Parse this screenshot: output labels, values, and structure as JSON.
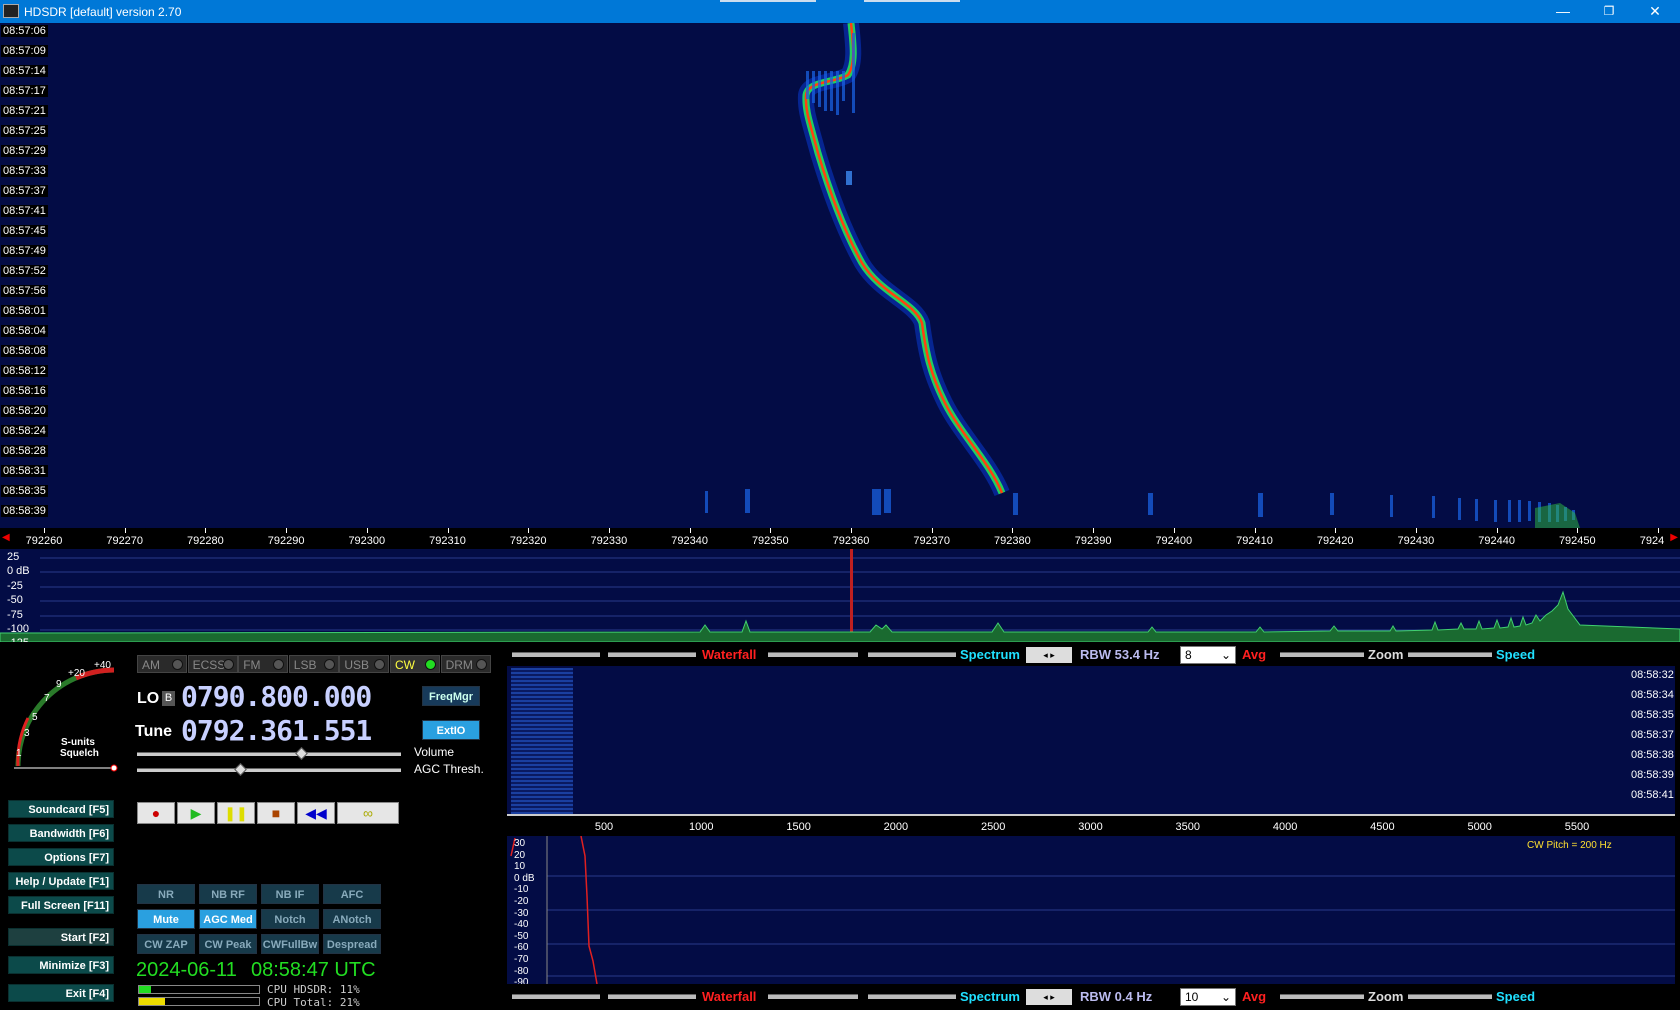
{
  "title": "HDSDR [default]  version 2.70",
  "window_buttons": {
    "minimize": "—",
    "restore": "❐",
    "close": "✕"
  },
  "waterfall": {
    "times": [
      "08:57:06",
      "08:57:09",
      "08:57:14",
      "08:57:17",
      "08:57:21",
      "08:57:25",
      "08:57:29",
      "08:57:33",
      "08:57:37",
      "08:57:41",
      "08:57:45",
      "08:57:49",
      "08:57:52",
      "08:57:56",
      "08:58:01",
      "08:58:04",
      "08:58:08",
      "08:58:12",
      "08:58:16",
      "08:58:20",
      "08:58:24",
      "08:58:28",
      "08:58:31",
      "08:58:35",
      "08:58:39"
    ],
    "frequencies": [
      "792260",
      "792270",
      "792280",
      "792290",
      "792300",
      "792310",
      "792320",
      "792330",
      "792340",
      "792350",
      "792360",
      "792370",
      "792380",
      "792390",
      "792400",
      "792410",
      "792420",
      "792430",
      "792440",
      "792450",
      "7924"
    ]
  },
  "spectrum": {
    "db_labels": [
      "25",
      "0 dB",
      "-25",
      "-50",
      "-75",
      "-100",
      "-125"
    ]
  },
  "smeter": {
    "labels": [
      "1",
      "3",
      "5",
      "7",
      "9",
      "+20",
      "+40"
    ],
    "caption1": "S-units",
    "caption2": "Squelch"
  },
  "modes": [
    {
      "label": "AM",
      "active": false
    },
    {
      "label": "ECSS",
      "active": false
    },
    {
      "label": "FM",
      "active": false
    },
    {
      "label": "LSB",
      "active": false
    },
    {
      "label": "USB",
      "active": false
    },
    {
      "label": "CW",
      "active": true
    },
    {
      "label": "DRM",
      "active": false
    }
  ],
  "lo": {
    "label": "LO",
    "badge": "B",
    "value": "0790.800.000"
  },
  "tune": {
    "label": "Tune",
    "value": "0792.361.551"
  },
  "freqmgr": "FreqMgr",
  "extio": "ExtIO",
  "volume_label": "Volume",
  "agc_label": "AGC Thresh.",
  "left_buttons": [
    {
      "label": "Soundcard  [F5]"
    },
    {
      "label": "Bandwidth  [F6]"
    },
    {
      "label": "Options  [F7]"
    },
    {
      "label": "Help / Update  [F1]"
    },
    {
      "label": "Full Screen  [F11]"
    },
    {
      "label": "Start  [F2]"
    },
    {
      "label": "Minimize  [F3]"
    },
    {
      "label": "Exit  [F4]"
    }
  ],
  "dsp_buttons": [
    {
      "label": "NR",
      "on": false
    },
    {
      "label": "NB RF",
      "on": false
    },
    {
      "label": "NB IF",
      "on": false
    },
    {
      "label": "AFC",
      "on": false
    },
    {
      "label": "Mute",
      "on": true
    },
    {
      "label": "AGC Med",
      "on": true
    },
    {
      "label": "Notch",
      "on": false
    },
    {
      "label": "ANotch",
      "on": false
    },
    {
      "label": "CW ZAP",
      "on": false
    },
    {
      "label": "CW Peak",
      "on": false
    },
    {
      "label": "CWFullBw",
      "on": false
    },
    {
      "label": "Despread",
      "on": false
    }
  ],
  "clock": {
    "date": "2024-06-11",
    "time": "08:58:47 UTC"
  },
  "cpu": {
    "hdsdr": "CPU HDSDR:  11%",
    "total": "CPU Total:  21%"
  },
  "rf_toolbar": {
    "waterfall": "Waterfall",
    "spectrum": "Spectrum",
    "rbw": "RBW  53.4 Hz",
    "avg_value": "8",
    "avg": "Avg",
    "zoom": "Zoom",
    "speed": "Speed"
  },
  "af_toolbar": {
    "waterfall": "Waterfall",
    "spectrum": "Spectrum",
    "rbw": "RBW  0.4 Hz",
    "avg_value": "10",
    "avg": "Avg",
    "zoom": "Zoom",
    "speed": "Speed"
  },
  "af_waterfall": {
    "times": [
      "08:58:32",
      "08:58:34",
      "08:58:35",
      "08:58:37",
      "08:58:38",
      "08:58:39",
      "08:58:41"
    ]
  },
  "af_freq_labels": [
    "500",
    "1000",
    "1500",
    "2000",
    "2500",
    "3000",
    "3500",
    "4000",
    "4500",
    "5000",
    "5500"
  ],
  "af_db_labels": [
    "30",
    "20",
    "10",
    "0 dB",
    "-10",
    "-20",
    "-30",
    "-40",
    "-50",
    "-60",
    "-70",
    "-80",
    "-90"
  ],
  "cw_pitch": "CW Pitch = 200 Hz",
  "colors": {
    "accent": "#0078d7",
    "waterfall_bg": "#030c45",
    "lcd": "#c8d0ff",
    "clock": "#22dd22",
    "button_on": "#2aa0e0"
  }
}
